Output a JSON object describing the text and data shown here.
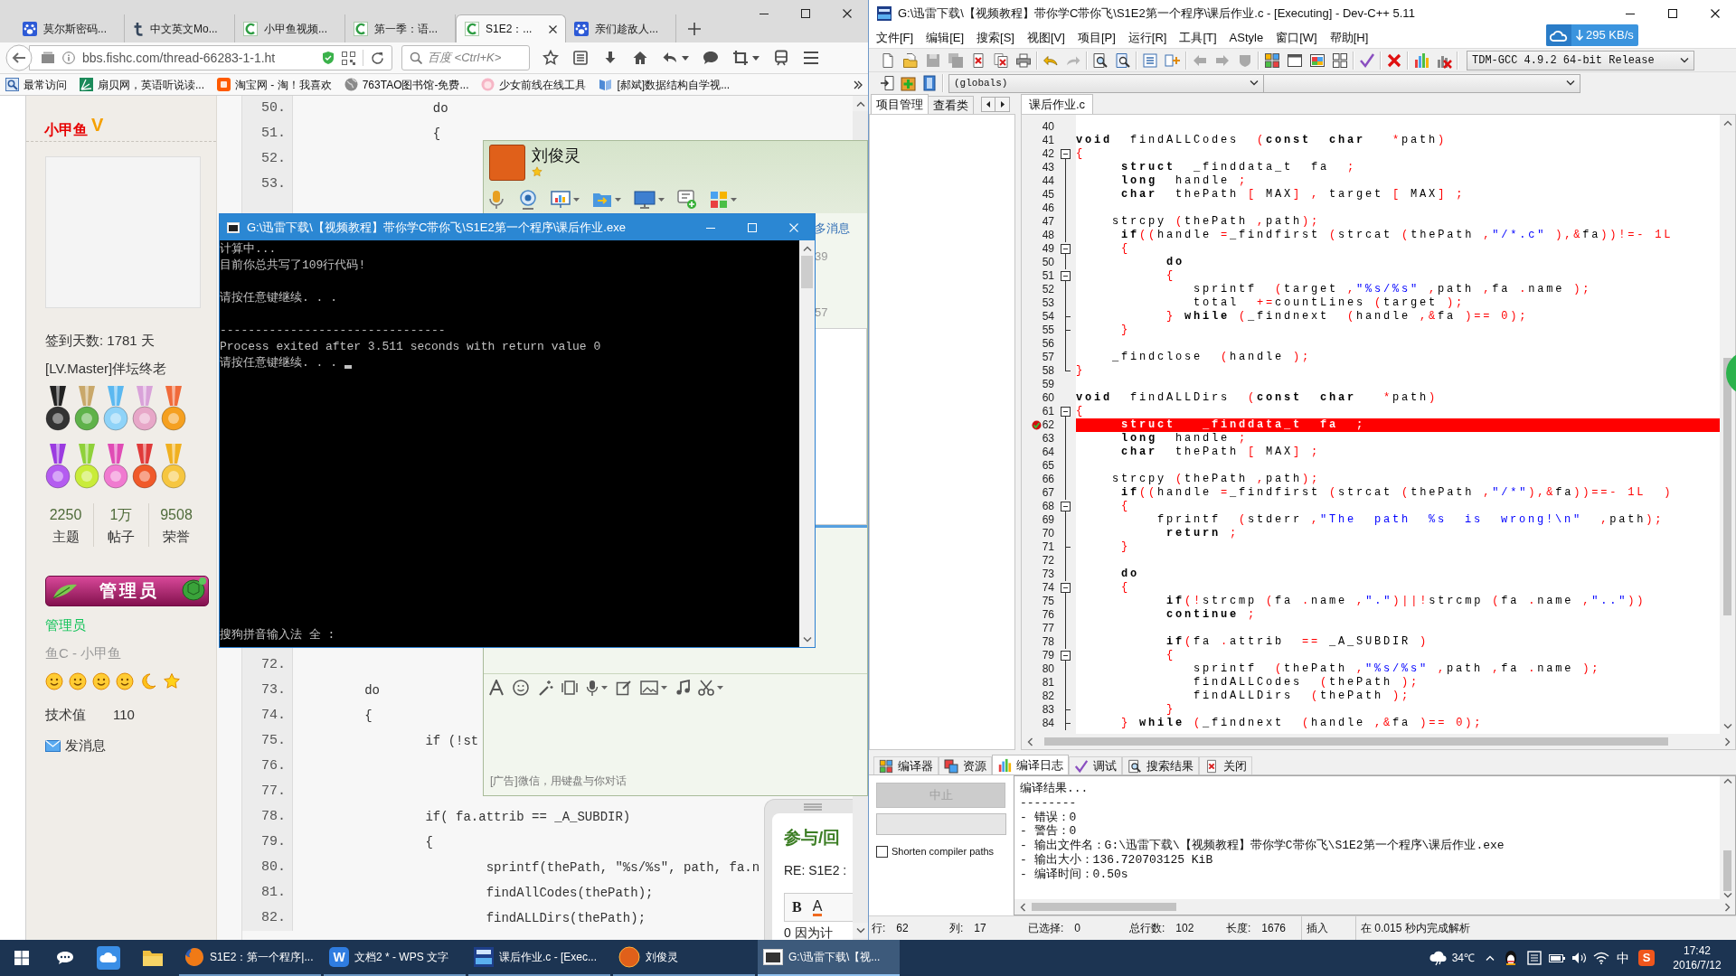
{
  "browser": {
    "tabs": [
      {
        "label": "莫尔斯密码...",
        "selected": false
      },
      {
        "label": "中文英文Mo...",
        "selected": false
      },
      {
        "label": "小甲鱼视频...",
        "selected": false
      },
      {
        "label": "第一季：语...",
        "selected": false
      },
      {
        "label": "S1E2：...",
        "selected": true
      },
      {
        "label": "亲们趁敌人...",
        "selected": false
      }
    ],
    "address": "bbs.fishc.com/thread-66283-1-1.ht",
    "search": {
      "placeholder": "百度 <Ctrl+K>"
    },
    "bookmarks": [
      "最常访问",
      "扇贝网，英语听说读...",
      "淘宝网 - 淘！我喜欢",
      "763TAO图书馆-免费...",
      "少女前线在线工具",
      "[郝斌]数据结构自学视..."
    ],
    "profile": {
      "name": "小甲鱼",
      "vip": "V",
      "checkin": "签到天数: 1781 天",
      "rank": "[LV.Master]伴坛终老",
      "stats": [
        {
          "value": "2250",
          "label": "主题"
        },
        {
          "value": "1万",
          "label": "帖子"
        },
        {
          "value": "9508",
          "label": "荣誉"
        }
      ],
      "banner": "管理员",
      "group": "管理员",
      "title": "鱼C - 小甲鱼",
      "skill": {
        "label": "技术值",
        "value": "110"
      },
      "message": "发消息"
    },
    "code_top": [
      {
        "number": "50.",
        "text": "                 do"
      },
      {
        "number": "51.",
        "text": "                 {"
      },
      {
        "number": "52."
      },
      {
        "number": "53."
      }
    ],
    "code_bottom": [
      {
        "number": "72."
      },
      {
        "number": "73.",
        "text": "        do"
      },
      {
        "number": "74.",
        "text": "        {"
      },
      {
        "number": "75.",
        "text": "                if (!st"
      },
      {
        "number": "76."
      },
      {
        "number": "77."
      },
      {
        "number": "78.",
        "text": "                if( fa.attrib == _A_SUBDIR)"
      },
      {
        "number": "79.",
        "text": "                {"
      },
      {
        "number": "80.",
        "text": "                        sprintf(thePath, \"%s/%s\", path, fa.n"
      },
      {
        "number": "81.",
        "text": "                        findAllCodes(thePath);"
      },
      {
        "number": "82.",
        "text": "                        findALLDirs(thePath);"
      }
    ]
  },
  "chat": {
    "name": "刘俊灵",
    "history": [
      "多消息",
      "39",
      "57"
    ],
    "ad": "[广告]微信，用键盘与你对话"
  },
  "reply": {
    "title": "参与/回",
    "subject": "RE: S1E2 :",
    "format_buttons": [
      {
        "label": "B",
        "kind": "bold"
      },
      {
        "label": "A",
        "kind": "color"
      }
    ],
    "body": "0 因为计"
  },
  "console": {
    "title": "G:\\迅雷下载\\【视频教程】带你学C带你飞\\S1E2第一个程序\\课后作业.exe",
    "blocks": [
      [
        "计算中...",
        "目前你总共写了109行代码!"
      ],
      [
        "请按任意键继续. . ."
      ],
      [
        "--------------------------------",
        "Process exited after 3.511 seconds with return value 0",
        "请按任意键继续. . ."
      ]
    ],
    "ime": "搜狗拼音输入法 全 :"
  },
  "devcpp": {
    "title": "G:\\迅雷下载\\【视频教程】带你学C带你飞\\S1E2第一个程序\\课后作业.c - [Executing] - Dev-C++ 5.11",
    "menu": [
      "文件[F]",
      "编辑[E]",
      "搜索[S]",
      "视图[V]",
      "项目[P]",
      "运行[R]",
      "工具[T]",
      "AStyle",
      "窗口[W]",
      "帮助[H]"
    ],
    "compiler": "TDM-GCC 4.9.2 64-bit Release",
    "scope": "(globals)",
    "side_tabs": [
      {
        "label": "项目管理",
        "selected": true
      },
      {
        "label": "查看类",
        "selected": false
      }
    ],
    "file_tabs": [
      {
        "label": "课后作业.c",
        "selected": true
      }
    ],
    "code": [
      {
        "number": "40",
        "kind": "none",
        "breakpoint": false
      },
      {
        "number": "41",
        "kind": "none",
        "breakpoint": false,
        "tokens": [
          {
            "kind": "keyword",
            "text": "void"
          },
          {
            "kind": "plain",
            "text": "  findALLCodes  "
          },
          {
            "kind": "symbol",
            "text": "("
          },
          {
            "kind": "keyword",
            "text": "const  char  "
          },
          {
            "kind": "symbol",
            "text": " *"
          },
          {
            "kind": "plain",
            "text": "path"
          },
          {
            "kind": "symbol",
            "text": ")"
          }
        ]
      },
      {
        "number": "42",
        "kind": "start",
        "breakpoint": false,
        "tokens": [
          {
            "kind": "symbol",
            "text": "{"
          }
        ]
      },
      {
        "number": "43",
        "kind": "middle",
        "breakpoint": false,
        "tokens": [
          {
            "kind": "keyword",
            "text": "     struct"
          },
          {
            "kind": "plain",
            "text": "  _finddata_t  fa  "
          },
          {
            "kind": "symbol",
            "text": ";"
          }
        ]
      },
      {
        "number": "44",
        "kind": "middle",
        "breakpoint": false,
        "tokens": [
          {
            "kind": "keyword",
            "text": "     long"
          },
          {
            "kind": "plain",
            "text": "  handle "
          },
          {
            "kind": "symbol",
            "text": ";"
          }
        ]
      },
      {
        "number": "45",
        "kind": "middle",
        "breakpoint": false,
        "tokens": [
          {
            "kind": "keyword",
            "text": "     char"
          },
          {
            "kind": "plain",
            "text": "  thePath "
          },
          {
            "kind": "symbol",
            "text": "["
          },
          {
            "kind": "plain",
            "text": " MAX"
          },
          {
            "kind": "symbol",
            "text": "] ,"
          },
          {
            "kind": "plain",
            "text": " target "
          },
          {
            "kind": "symbol",
            "text": "["
          },
          {
            "kind": "plain",
            "text": " MAX"
          },
          {
            "kind": "symbol",
            "text": "] ;"
          }
        ]
      },
      {
        "number": "46",
        "kind": "middle",
        "breakpoint": false
      },
      {
        "number": "47",
        "kind": "middle",
        "breakpoint": false,
        "tokens": [
          {
            "kind": "plain",
            "text": "    strcpy "
          },
          {
            "kind": "symbol",
            "text": "("
          },
          {
            "kind": "plain",
            "text": "thePath "
          },
          {
            "kind": "symbol",
            "text": ","
          },
          {
            "kind": "plain",
            "text": "path"
          },
          {
            "kind": "symbol",
            "text": ");"
          }
        ]
      },
      {
        "number": "48",
        "kind": "middle",
        "breakpoint": false,
        "tokens": [
          {
            "kind": "keyword",
            "text": "     if"
          },
          {
            "kind": "symbol",
            "text": "(("
          },
          {
            "kind": "plain",
            "text": "handle "
          },
          {
            "kind": "symbol",
            "text": "="
          },
          {
            "kind": "plain",
            "text": "_findfirst "
          },
          {
            "kind": "symbol",
            "text": "("
          },
          {
            "kind": "plain",
            "text": "strcat "
          },
          {
            "kind": "symbol",
            "text": "("
          },
          {
            "kind": "plain",
            "text": "thePath "
          },
          {
            "kind": "symbol",
            "text": ","
          },
          {
            "kind": "string",
            "text": "\"/*.c\" "
          },
          {
            "kind": "symbol",
            "text": "),&"
          },
          {
            "kind": "plain",
            "text": "fa"
          },
          {
            "kind": "symbol",
            "text": "))!=- 1L"
          }
        ]
      },
      {
        "number": "49",
        "kind": "start",
        "breakpoint": false,
        "tokens": [
          {
            "kind": "symbol",
            "text": "     {"
          }
        ]
      },
      {
        "number": "50",
        "kind": "middle",
        "breakpoint": false,
        "tokens": [
          {
            "kind": "keyword",
            "text": "          do"
          }
        ]
      },
      {
        "number": "51",
        "kind": "start",
        "breakpoint": false,
        "tokens": [
          {
            "kind": "symbol",
            "text": "          {"
          }
        ]
      },
      {
        "number": "52",
        "kind": "middle",
        "breakpoint": false,
        "tokens": [
          {
            "kind": "plain",
            "text": "             sprintf  "
          },
          {
            "kind": "symbol",
            "text": "("
          },
          {
            "kind": "plain",
            "text": "target "
          },
          {
            "kind": "symbol",
            "text": ","
          },
          {
            "kind": "string",
            "text": "\"%s/%s\" "
          },
          {
            "kind": "symbol",
            "text": ","
          },
          {
            "kind": "plain",
            "text": "path "
          },
          {
            "kind": "symbol",
            "text": ","
          },
          {
            "kind": "plain",
            "text": "fa "
          },
          {
            "kind": "symbol",
            "text": "."
          },
          {
            "kind": "plain",
            "text": "name "
          },
          {
            "kind": "symbol",
            "text": ");"
          }
        ]
      },
      {
        "number": "53",
        "kind": "middle",
        "breakpoint": false,
        "tokens": [
          {
            "kind": "plain",
            "text": "             total  "
          },
          {
            "kind": "symbol",
            "text": "+="
          },
          {
            "kind": "plain",
            "text": "countLines "
          },
          {
            "kind": "symbol",
            "text": "("
          },
          {
            "kind": "plain",
            "text": "target "
          },
          {
            "kind": "symbol",
            "text": ");"
          }
        ]
      },
      {
        "number": "54",
        "kind": "end",
        "breakpoint": false,
        "tokens": [
          {
            "kind": "symbol",
            "text": "          }"
          },
          {
            "kind": "keyword",
            "text": " while "
          },
          {
            "kind": "symbol",
            "text": "("
          },
          {
            "kind": "plain",
            "text": "_findnext  "
          },
          {
            "kind": "symbol",
            "text": "("
          },
          {
            "kind": "plain",
            "text": "handle "
          },
          {
            "kind": "symbol",
            "text": ",&"
          },
          {
            "kind": "plain",
            "text": "fa "
          },
          {
            "kind": "symbol",
            "text": ")== 0);"
          }
        ]
      },
      {
        "number": "55",
        "kind": "end",
        "breakpoint": false,
        "tokens": [
          {
            "kind": "symbol",
            "text": "     }"
          }
        ]
      },
      {
        "number": "56",
        "kind": "middle",
        "breakpoint": false
      },
      {
        "number": "57",
        "kind": "middle",
        "breakpoint": false,
        "tokens": [
          {
            "kind": "plain",
            "text": "    _findclose  "
          },
          {
            "kind": "symbol",
            "text": "("
          },
          {
            "kind": "plain",
            "text": "handle "
          },
          {
            "kind": "symbol",
            "text": ");"
          }
        ]
      },
      {
        "number": "58",
        "kind": "last",
        "breakpoint": false,
        "tokens": [
          {
            "kind": "symbol",
            "text": "}"
          }
        ]
      },
      {
        "number": "59",
        "kind": "none",
        "breakpoint": false
      },
      {
        "number": "60",
        "kind": "none",
        "breakpoint": false,
        "tokens": [
          {
            "kind": "keyword",
            "text": "void"
          },
          {
            "kind": "plain",
            "text": "  findALLDirs  "
          },
          {
            "kind": "symbol",
            "text": "("
          },
          {
            "kind": "keyword",
            "text": "const  char  "
          },
          {
            "kind": "symbol",
            "text": " *"
          },
          {
            "kind": "plain",
            "text": "path"
          },
          {
            "kind": "symbol",
            "text": ")"
          }
        ]
      },
      {
        "number": "61",
        "kind": "start",
        "breakpoint": false,
        "tokens": [
          {
            "kind": "symbol",
            "text": "{"
          }
        ]
      },
      {
        "number": "62",
        "kind": "middle",
        "breakpoint": true,
        "tokens": [
          {
            "kind": "keyword",
            "text": "     struct"
          },
          {
            "kind": "plain",
            "text": "   _finddata_t  fa  "
          },
          {
            "kind": "symbol",
            "text": ";"
          }
        ]
      },
      {
        "number": "63",
        "kind": "middle",
        "breakpoint": false,
        "tokens": [
          {
            "kind": "keyword",
            "text": "     long"
          },
          {
            "kind": "plain",
            "text": "  handle "
          },
          {
            "kind": "symbol",
            "text": ";"
          }
        ]
      },
      {
        "number": "64",
        "kind": "middle",
        "breakpoint": false,
        "tokens": [
          {
            "kind": "keyword",
            "text": "     char"
          },
          {
            "kind": "plain",
            "text": "  thePath "
          },
          {
            "kind": "symbol",
            "text": "["
          },
          {
            "kind": "plain",
            "text": " MAX"
          },
          {
            "kind": "symbol",
            "text": "] ;"
          }
        ]
      },
      {
        "number": "65",
        "kind": "middle",
        "breakpoint": false
      },
      {
        "number": "66",
        "kind": "middle",
        "breakpoint": false,
        "tokens": [
          {
            "kind": "plain",
            "text": "    strcpy "
          },
          {
            "kind": "symbol",
            "text": "("
          },
          {
            "kind": "plain",
            "text": "thePath "
          },
          {
            "kind": "symbol",
            "text": ","
          },
          {
            "kind": "plain",
            "text": "path"
          },
          {
            "kind": "symbol",
            "text": ");"
          }
        ]
      },
      {
        "number": "67",
        "kind": "middle",
        "breakpoint": false,
        "tokens": [
          {
            "kind": "keyword",
            "text": "     if"
          },
          {
            "kind": "symbol",
            "text": "(("
          },
          {
            "kind": "plain",
            "text": "handle "
          },
          {
            "kind": "symbol",
            "text": "="
          },
          {
            "kind": "plain",
            "text": "_findfirst "
          },
          {
            "kind": "symbol",
            "text": "("
          },
          {
            "kind": "plain",
            "text": "strcat "
          },
          {
            "kind": "symbol",
            "text": "("
          },
          {
            "kind": "plain",
            "text": "thePath "
          },
          {
            "kind": "symbol",
            "text": ","
          },
          {
            "kind": "string",
            "text": "\"/*\""
          },
          {
            "kind": "symbol",
            "text": "),&"
          },
          {
            "kind": "plain",
            "text": "fa"
          },
          {
            "kind": "symbol",
            "text": "))==- 1L  )"
          }
        ]
      },
      {
        "number": "68",
        "kind": "start",
        "breakpoint": false,
        "tokens": [
          {
            "kind": "symbol",
            "text": "     {"
          }
        ]
      },
      {
        "number": "69",
        "kind": "middle",
        "breakpoint": false,
        "tokens": [
          {
            "kind": "plain",
            "text": "         fprintf  "
          },
          {
            "kind": "symbol",
            "text": "("
          },
          {
            "kind": "plain",
            "text": "stderr "
          },
          {
            "kind": "symbol",
            "text": ","
          },
          {
            "kind": "string",
            "text": "\"The  path  %s  is  wrong!\\n\"  "
          },
          {
            "kind": "symbol",
            "text": ","
          },
          {
            "kind": "plain",
            "text": "path"
          },
          {
            "kind": "symbol",
            "text": ");"
          }
        ]
      },
      {
        "number": "70",
        "kind": "middle",
        "breakpoint": false,
        "tokens": [
          {
            "kind": "keyword",
            "text": "          return"
          },
          {
            "kind": "symbol",
            "text": " ;"
          }
        ]
      },
      {
        "number": "71",
        "kind": "end",
        "breakpoint": false,
        "tokens": [
          {
            "kind": "symbol",
            "text": "     }"
          }
        ]
      },
      {
        "number": "72",
        "kind": "middle",
        "breakpoint": false
      },
      {
        "number": "73",
        "kind": "middle",
        "breakpoint": false,
        "tokens": [
          {
            "kind": "keyword",
            "text": "     do"
          }
        ]
      },
      {
        "number": "74",
        "kind": "start",
        "breakpoint": false,
        "tokens": [
          {
            "kind": "symbol",
            "text": "     {"
          }
        ]
      },
      {
        "number": "75",
        "kind": "middle",
        "breakpoint": false,
        "tokens": [
          {
            "kind": "keyword",
            "text": "          if"
          },
          {
            "kind": "symbol",
            "text": "(!"
          },
          {
            "kind": "plain",
            "text": "strcmp "
          },
          {
            "kind": "symbol",
            "text": "("
          },
          {
            "kind": "plain",
            "text": "fa "
          },
          {
            "kind": "symbol",
            "text": "."
          },
          {
            "kind": "plain",
            "text": "name "
          },
          {
            "kind": "symbol",
            "text": ","
          },
          {
            "kind": "string",
            "text": "\".\""
          },
          {
            "kind": "symbol",
            "text": ")||!"
          },
          {
            "kind": "plain",
            "text": "strcmp "
          },
          {
            "kind": "symbol",
            "text": "("
          },
          {
            "kind": "plain",
            "text": "fa "
          },
          {
            "kind": "symbol",
            "text": "."
          },
          {
            "kind": "plain",
            "text": "name "
          },
          {
            "kind": "symbol",
            "text": ","
          },
          {
            "kind": "string",
            "text": "\"..\""
          },
          {
            "kind": "symbol",
            "text": "))"
          }
        ]
      },
      {
        "number": "76",
        "kind": "middle",
        "breakpoint": false,
        "tokens": [
          {
            "kind": "keyword",
            "text": "          continue"
          },
          {
            "kind": "symbol",
            "text": " ;"
          }
        ]
      },
      {
        "number": "77",
        "kind": "middle",
        "breakpoint": false
      },
      {
        "number": "78",
        "kind": "middle",
        "breakpoint": false,
        "tokens": [
          {
            "kind": "keyword",
            "text": "          if"
          },
          {
            "kind": "symbol",
            "text": "("
          },
          {
            "kind": "plain",
            "text": "fa "
          },
          {
            "kind": "symbol",
            "text": "."
          },
          {
            "kind": "plain",
            "text": "attrib  "
          },
          {
            "kind": "symbol",
            "text": "=="
          },
          {
            "kind": "plain",
            "text": " _A_SUBDIR "
          },
          {
            "kind": "symbol",
            "text": ")"
          }
        ]
      },
      {
        "number": "79",
        "kind": "start",
        "breakpoint": false,
        "tokens": [
          {
            "kind": "symbol",
            "text": "          {"
          }
        ]
      },
      {
        "number": "80",
        "kind": "middle",
        "breakpoint": false,
        "tokens": [
          {
            "kind": "plain",
            "text": "             sprintf  "
          },
          {
            "kind": "symbol",
            "text": "("
          },
          {
            "kind": "plain",
            "text": "thePath "
          },
          {
            "kind": "symbol",
            "text": ","
          },
          {
            "kind": "string",
            "text": "\"%s/%s\" "
          },
          {
            "kind": "symbol",
            "text": ","
          },
          {
            "kind": "plain",
            "text": "path "
          },
          {
            "kind": "symbol",
            "text": ","
          },
          {
            "kind": "plain",
            "text": "fa "
          },
          {
            "kind": "symbol",
            "text": "."
          },
          {
            "kind": "plain",
            "text": "name "
          },
          {
            "kind": "symbol",
            "text": ");"
          }
        ]
      },
      {
        "number": "81",
        "kind": "middle",
        "breakpoint": false,
        "tokens": [
          {
            "kind": "plain",
            "text": "             findALLCodes  "
          },
          {
            "kind": "symbol",
            "text": "("
          },
          {
            "kind": "plain",
            "text": "thePath "
          },
          {
            "kind": "symbol",
            "text": ");"
          }
        ]
      },
      {
        "number": "82",
        "kind": "middle",
        "breakpoint": false,
        "tokens": [
          {
            "kind": "plain",
            "text": "             findALLDirs  "
          },
          {
            "kind": "symbol",
            "text": "("
          },
          {
            "kind": "plain",
            "text": "thePath "
          },
          {
            "kind": "symbol",
            "text": ");"
          }
        ]
      },
      {
        "number": "83",
        "kind": "end",
        "breakpoint": false,
        "tokens": [
          {
            "kind": "symbol",
            "text": "          }"
          }
        ]
      },
      {
        "number": "84",
        "kind": "end",
        "breakpoint": false,
        "tokens": [
          {
            "kind": "symbol",
            "text": "     }"
          },
          {
            "kind": "keyword",
            "text": " while "
          },
          {
            "kind": "symbol",
            "text": "("
          },
          {
            "kind": "plain",
            "text": "_findnext  "
          },
          {
            "kind": "symbol",
            "text": "("
          },
          {
            "kind": "plain",
            "text": "handle "
          },
          {
            "kind": "symbol",
            "text": ",&"
          },
          {
            "kind": "plain",
            "text": "fa "
          },
          {
            "kind": "symbol",
            "text": ")== 0);"
          }
        ]
      }
    ],
    "bottom_tabs": [
      {
        "label": "编译器",
        "selected": false
      },
      {
        "label": "资源",
        "selected": false
      },
      {
        "label": "编译日志",
        "selected": true
      },
      {
        "label": "调试",
        "selected": false
      },
      {
        "label": "搜索结果",
        "selected": false
      },
      {
        "label": "关闭",
        "selected": false
      }
    ],
    "abort_button": {
      "label": "中止",
      "disabled": true
    },
    "progress": {
      "level": 0
    },
    "shorten_paths": {
      "label": "Shorten compiler paths",
      "checked": false
    },
    "log": [
      "编译结果...",
      "--------",
      "- 错误：0",
      "- 警告：0",
      "- 输出文件名：G:\\迅雷下载\\【视频教程】带你学C带你飞\\S1E2第一个程序\\课后作业.exe",
      "- 输出大小：136.720703125 KiB",
      "- 编译时间：0.50s"
    ],
    "status": [
      {
        "label": "行:",
        "value": "62"
      },
      {
        "label": "列:",
        "value": "17"
      },
      {
        "label": "已选择:",
        "value": "0"
      },
      {
        "label": "总行数:",
        "value": "102"
      },
      {
        "label": "长度:",
        "value": "1676"
      },
      {
        "label": "插入"
      },
      {
        "label": "在 0.015 秒内完成解析"
      }
    ]
  },
  "net_speed": "295 KB/s",
  "taskbar": {
    "apps": [
      {
        "label": "S1E2：第一个程序|...",
        "selected": false
      },
      {
        "label": "文档2 * - WPS 文字",
        "selected": false,
        "logo": "W"
      },
      {
        "label": "课后作业.c - [Exec...",
        "selected": false
      },
      {
        "label": "刘俊灵",
        "selected": false
      },
      {
        "label": "G:\\迅雷下载\\【视...",
        "selected": true
      }
    ],
    "weather": "34℃",
    "ime": "中",
    "ime_logo": "S",
    "time": "17:42",
    "date": "2016/7/12"
  }
}
